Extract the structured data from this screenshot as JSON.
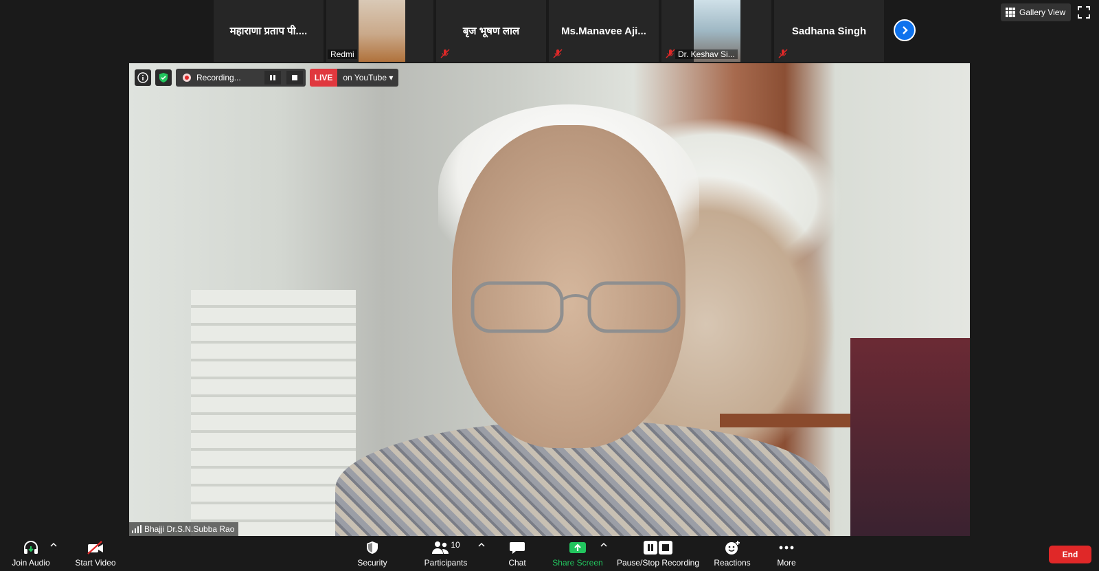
{
  "gallery": {
    "tiles": [
      {
        "name": "महाराणा प्रताप पी....",
        "muted": false
      },
      {
        "caption": "Redmi",
        "has_video": true
      },
      {
        "name": "बृज भूषण लाल",
        "muted": true
      },
      {
        "name": "Ms.Manavee  Aji...",
        "muted": true
      },
      {
        "caption": "Dr. Keshav Si...",
        "has_video": true,
        "muted": true
      },
      {
        "name": "Sadhana Singh",
        "muted": true
      }
    ],
    "view_label": "Gallery View"
  },
  "video": {
    "recording_label": "Recording...",
    "live_badge": "LIVE",
    "live_target": "on YouTube",
    "speaker_name": "Bhajji Dr.S.N.Subba Rao"
  },
  "toolbar": {
    "join_audio": "Join Audio",
    "start_video": "Start Video",
    "security": "Security",
    "participants": "Participants",
    "participants_count": "10",
    "chat": "Chat",
    "share_screen": "Share Screen",
    "pause_stop_recording": "Pause/Stop Recording",
    "reactions": "Reactions",
    "more": "More",
    "end": "End"
  },
  "colors": {
    "background": "#1a1a1a",
    "accent_blue": "#0e72ed",
    "share_green": "#22c55e",
    "end_red": "#e02828",
    "live_red": "#e0383e"
  }
}
